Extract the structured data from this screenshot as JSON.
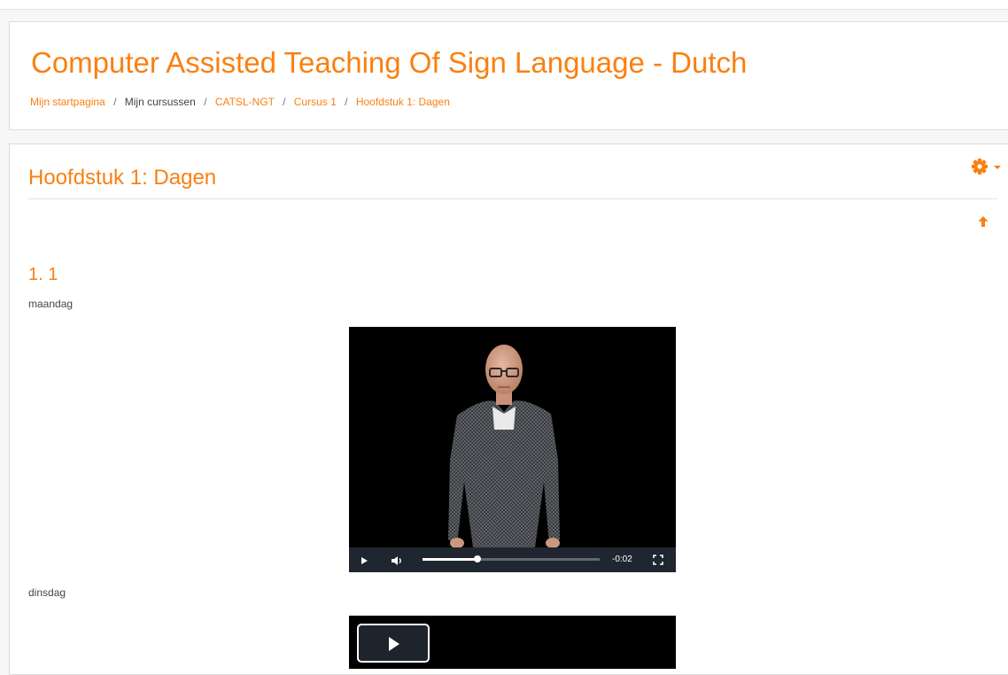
{
  "header": {
    "course_title": "Computer Assisted Teaching Of Sign Language - Dutch",
    "breadcrumb": [
      {
        "label": "Mijn startpagina",
        "link": true
      },
      {
        "label": "Mijn cursussen",
        "link": false
      },
      {
        "label": "CATSL-NGT",
        "link": true
      },
      {
        "label": "Cursus 1",
        "link": true
      },
      {
        "label": "Hoofdstuk 1: Dagen",
        "link": true
      }
    ],
    "separator": "/"
  },
  "main": {
    "section_title": "Hoofdstuk 1: Dagen",
    "subsection_title": "1. 1",
    "items": [
      {
        "label": "maandag",
        "video": {
          "time": "-0:02",
          "progress": 0.31
        }
      },
      {
        "label": "dinsdag",
        "video": {
          "state": "not-started"
        }
      }
    ]
  },
  "icons": {
    "settings": "gear-icon",
    "settings_caret": "caret-down-icon",
    "move_up": "arrow-up-icon",
    "play": "play-icon",
    "volume": "volume-icon",
    "fullscreen": "fullscreen-icon"
  },
  "colors": {
    "accent": "#f98012",
    "text": "#444444",
    "video_bg": "#000000"
  }
}
